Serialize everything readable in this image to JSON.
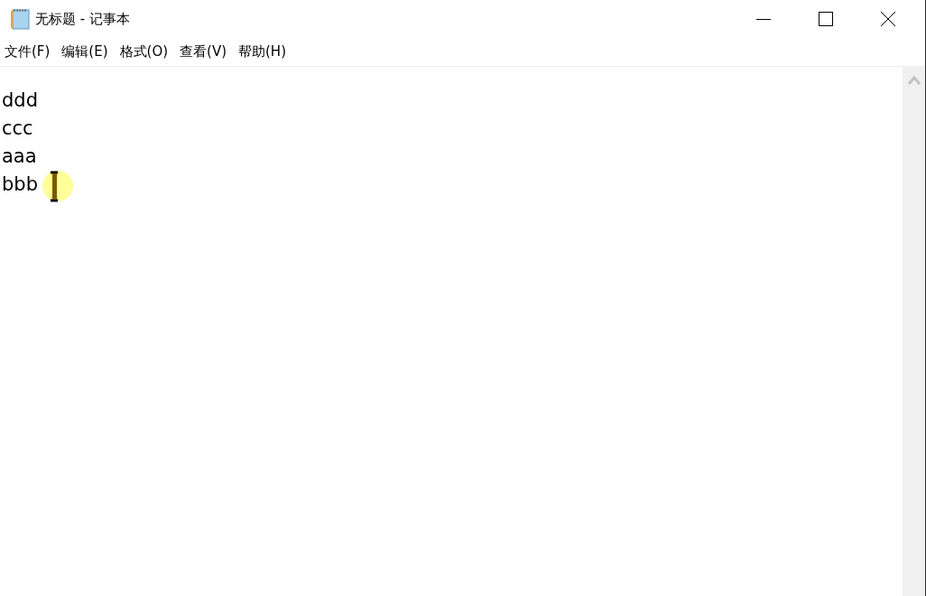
{
  "window": {
    "title": "无标题 - 记事本"
  },
  "menu": [
    "文件(F)",
    "编辑(E)",
    "格式(O)",
    "查看(V)",
    "帮助(H)"
  ],
  "editor": {
    "lines": [
      "ddd",
      "ccc",
      "aaa",
      "bbb"
    ]
  }
}
